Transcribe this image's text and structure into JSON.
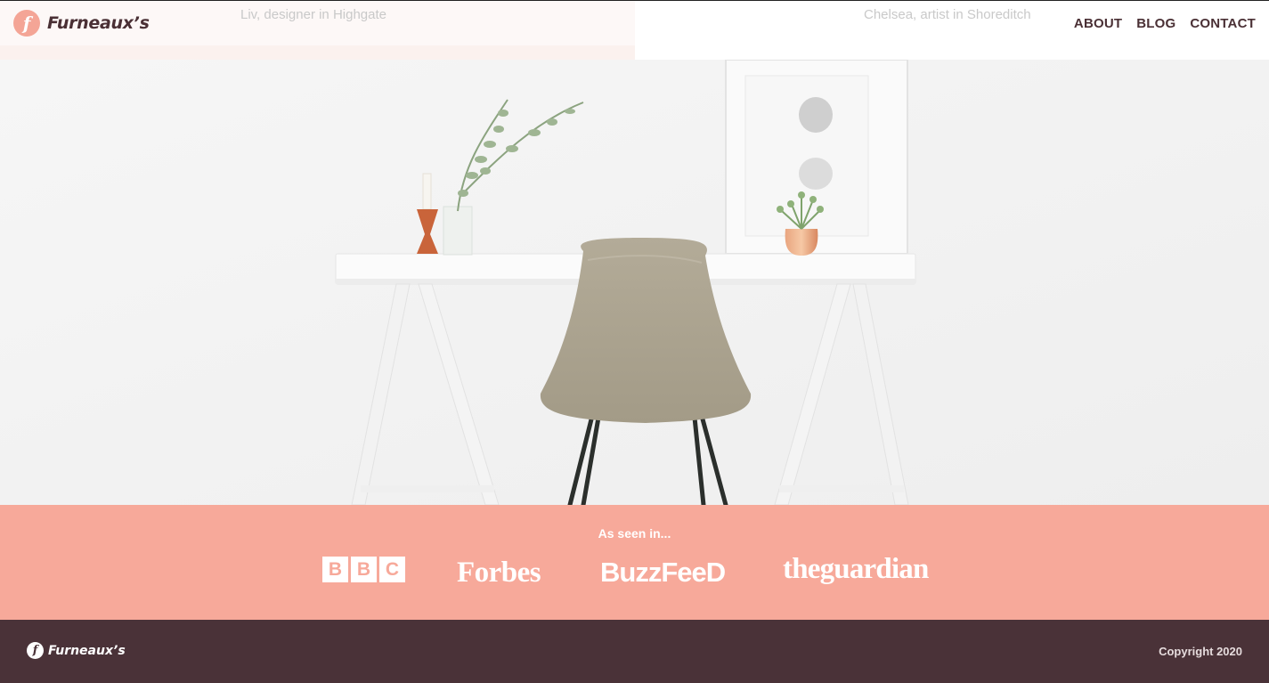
{
  "brand": {
    "name": "Furneaux’s",
    "badge_letter": "f"
  },
  "header": {
    "testimonials": [
      "Liv, designer in Highgate",
      "Chelsea, artist in Shoreditch"
    ]
  },
  "nav": {
    "items": [
      {
        "label": "ABOUT"
      },
      {
        "label": "BLOG"
      },
      {
        "label": "CONTACT"
      }
    ]
  },
  "hero": {
    "image": "minimal-white-desk-with-chair-photo"
  },
  "press": {
    "title": "As seen in...",
    "logos": {
      "bbc": [
        "B",
        "B",
        "C"
      ],
      "forbes": "Forbes",
      "buzzfeed": "BuzzFeeD",
      "guardian": "theguardian"
    }
  },
  "footer": {
    "brand": "Furneaux’s",
    "copyright": "Copyright 2020"
  },
  "colors": {
    "brand_dark": "#4a3238",
    "accent_coral": "#f7a99a",
    "badge_coral": "#f4a596",
    "muted_text": "#c9c9c9"
  }
}
